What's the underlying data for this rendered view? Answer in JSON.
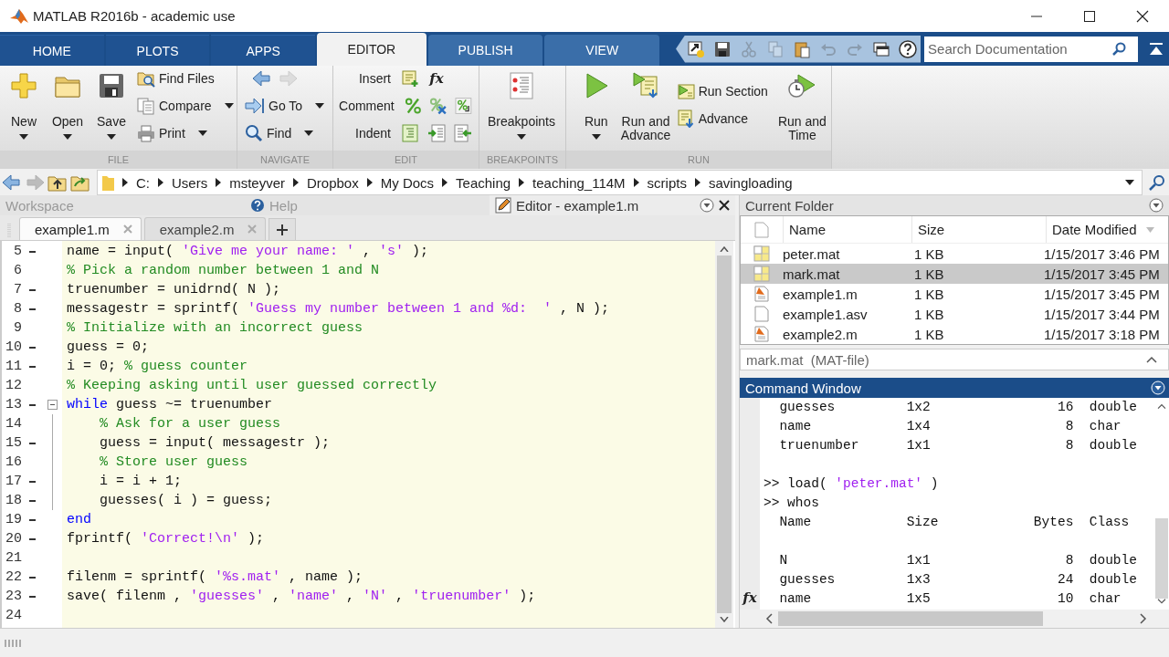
{
  "window": {
    "title": "MATLAB R2016b - academic use"
  },
  "tabs": [
    {
      "label": "HOME",
      "selected": false,
      "kind": "standard"
    },
    {
      "label": "PLOTS",
      "selected": false,
      "kind": "standard"
    },
    {
      "label": "APPS",
      "selected": false,
      "kind": "standard"
    },
    {
      "label": "EDITOR",
      "selected": true,
      "kind": "contextual"
    },
    {
      "label": "PUBLISH",
      "selected": false,
      "kind": "contextual"
    },
    {
      "label": "VIEW",
      "selected": false,
      "kind": "contextual"
    }
  ],
  "quick_access": [
    {
      "disabled": false
    },
    {
      "disabled": false
    },
    {
      "disabled": true
    },
    {
      "disabled": true
    },
    {
      "disabled": false
    },
    {
      "disabled": true
    },
    {
      "disabled": true
    },
    {
      "disabled": false
    },
    {
      "disabled": false
    }
  ],
  "search": {
    "placeholder": "Search Documentation"
  },
  "ribbon": {
    "groups": [
      {
        "label": "FILE",
        "items": [
          {
            "kind": "large",
            "label": "New",
            "dropdown": true
          },
          {
            "kind": "large",
            "label": "Open",
            "dropdown": true
          },
          {
            "kind": "large",
            "label": "Save",
            "dropdown": true
          },
          {
            "kind": "stack",
            "items": [
              {
                "kind": "button",
                "label": "Find Files",
                "dropdown": false
              },
              {
                "kind": "button",
                "label": "Compare",
                "dropdown": true
              },
              {
                "kind": "button",
                "label": "Print",
                "dropdown": true
              }
            ]
          }
        ]
      },
      {
        "label": "NAVIGATE",
        "items": [
          {
            "kind": "stack",
            "items": [
              {
                "kind": "arrows",
                "buttons": [
                  {
                    "disabled": false
                  },
                  {
                    "disabled": true
                  }
                ]
              },
              {
                "kind": "button",
                "label": "Go To",
                "dropdown": true
              },
              {
                "kind": "button",
                "label": "Find",
                "dropdown": true
              }
            ]
          }
        ]
      },
      {
        "label": "EDIT",
        "items": [
          {
            "kind": "stack",
            "items": [
              {
                "kind": "tools",
                "label": "Insert",
                "tools": [
                  {
                    "kind": "icon"
                  },
                  {
                    "kind": "symbol",
                    "symbol": "fx"
                  }
                ]
              },
              {
                "kind": "tools",
                "label": "Comment",
                "tools": [
                  {
                    "kind": "icon"
                  },
                  {
                    "kind": "icon"
                  },
                  {
                    "kind": "icon"
                  }
                ]
              },
              {
                "kind": "tools",
                "label": "Indent",
                "tools": [
                  {
                    "kind": "icon"
                  },
                  {
                    "kind": "icon"
                  },
                  {
                    "kind": "icon"
                  }
                ]
              }
            ]
          }
        ]
      },
      {
        "label": "BREAKPOINTS",
        "items": [
          {
            "kind": "large",
            "label": "Breakpoints",
            "dropdown": true
          }
        ]
      },
      {
        "label": "RUN",
        "items": [
          {
            "kind": "large",
            "label": "Run",
            "dropdown": true
          },
          {
            "kind": "large",
            "label": "Run and Advance",
            "dropdown": false
          },
          {
            "kind": "stack",
            "items": [
              {
                "kind": "button",
                "label": "Run Section",
                "dropdown": false
              },
              {
                "kind": "button",
                "label": "Advance",
                "dropdown": false
              }
            ]
          },
          {
            "kind": "large",
            "label": "Run and Time",
            "dropdown": false
          }
        ]
      }
    ]
  },
  "path_bar": {
    "nav": [
      {
        "disabled": false
      },
      {
        "disabled": true
      },
      {
        "disabled": false
      },
      {
        "disabled": false
      }
    ],
    "segments": [
      "C:",
      "Users",
      "msteyver",
      "Dropbox",
      "My Docs",
      "Teaching",
      "teaching_114M",
      "scripts",
      "savingloading"
    ]
  },
  "panel_tabs": [
    {
      "label": "Workspace",
      "selected": false
    },
    {
      "label": "Help",
      "selected": false
    },
    {
      "label": "Editor - example1.m",
      "selected": true
    }
  ],
  "document_tabs": [
    {
      "label": "example1.m",
      "selected": true
    },
    {
      "label": "example2.m",
      "selected": false
    }
  ],
  "code": {
    "lines": [
      {
        "number": "5",
        "executable": true,
        "tokens": [
          {
            "kind": "plain",
            "text": "name = input( "
          },
          {
            "kind": "string",
            "text": "'Give me your name: '"
          },
          {
            "kind": "plain",
            "text": " , "
          },
          {
            "kind": "string",
            "text": "'s'"
          },
          {
            "kind": "plain",
            "text": " );"
          }
        ]
      },
      {
        "number": "6",
        "executable": false,
        "tokens": [
          {
            "kind": "comment",
            "text": "% Pick a random number between 1 and N"
          }
        ]
      },
      {
        "number": "7",
        "executable": true,
        "tokens": [
          {
            "kind": "plain",
            "text": "truenumber = unidrnd( N );"
          }
        ]
      },
      {
        "number": "8",
        "executable": true,
        "tokens": [
          {
            "kind": "plain",
            "text": "messagestr = sprintf( "
          },
          {
            "kind": "string",
            "text": "'Guess my number between 1 and %d:  '"
          },
          {
            "kind": "plain",
            "text": " , N );"
          }
        ]
      },
      {
        "number": "9",
        "executable": false,
        "tokens": [
          {
            "kind": "comment",
            "text": "% Initialize with an incorrect guess"
          }
        ]
      },
      {
        "number": "10",
        "executable": true,
        "tokens": [
          {
            "kind": "plain",
            "text": "guess = 0;"
          }
        ]
      },
      {
        "number": "11",
        "executable": true,
        "tokens": [
          {
            "kind": "plain",
            "text": "i = 0; "
          },
          {
            "kind": "comment",
            "text": "% guess counter"
          }
        ]
      },
      {
        "number": "12",
        "executable": false,
        "tokens": [
          {
            "kind": "comment",
            "text": "% Keeping asking until user guessed correctly"
          }
        ]
      },
      {
        "number": "13",
        "executable": true,
        "expanded": true,
        "tokens": [
          {
            "kind": "keyword",
            "text": "while"
          },
          {
            "kind": "plain",
            "text": " guess ~= truenumber"
          }
        ],
        "children": [
          {
            "number": "14",
            "executable": false,
            "tokens": [
              {
                "kind": "comment",
                "text": "% Ask for a user guess"
              }
            ]
          },
          {
            "number": "15",
            "executable": true,
            "tokens": [
              {
                "kind": "plain",
                "text": "guess = input( messagestr );"
              }
            ]
          },
          {
            "number": "16",
            "executable": false,
            "tokens": [
              {
                "kind": "comment",
                "text": "% Store user guess"
              }
            ]
          },
          {
            "number": "17",
            "executable": true,
            "tokens": [
              {
                "kind": "plain",
                "text": "i = i + 1;"
              }
            ]
          },
          {
            "number": "18",
            "executable": true,
            "tokens": [
              {
                "kind": "plain",
                "text": "guesses( i ) = guess;"
              }
            ]
          }
        ]
      },
      {
        "number": "19",
        "executable": true,
        "tokens": [
          {
            "kind": "keyword",
            "text": "end"
          }
        ]
      },
      {
        "number": "20",
        "executable": true,
        "tokens": [
          {
            "kind": "plain",
            "text": "fprintf( "
          },
          {
            "kind": "string",
            "text": "'Correct!\\n'"
          },
          {
            "kind": "plain",
            "text": " );"
          }
        ]
      },
      {
        "number": "21",
        "executable": false
      },
      {
        "number": "22",
        "executable": true,
        "tokens": [
          {
            "kind": "plain",
            "text": "filenm = sprintf( "
          },
          {
            "kind": "string",
            "text": "'%s.mat'"
          },
          {
            "kind": "plain",
            "text": " , name );"
          }
        ]
      },
      {
        "number": "23",
        "executable": true,
        "tokens": [
          {
            "kind": "plain",
            "text": "save( filenm , "
          },
          {
            "kind": "string",
            "text": "'guesses'"
          },
          {
            "kind": "plain",
            "text": " , "
          },
          {
            "kind": "string",
            "text": "'name'"
          },
          {
            "kind": "plain",
            "text": " , "
          },
          {
            "kind": "string",
            "text": "'N'"
          },
          {
            "kind": "plain",
            "text": " , "
          },
          {
            "kind": "string",
            "text": "'truenumber'"
          },
          {
            "kind": "plain",
            "text": " );"
          }
        ]
      },
      {
        "number": "24",
        "executable": false
      }
    ]
  },
  "current_folder": {
    "title": "Current Folder",
    "columns": [
      {
        "label": "Name",
        "sorted": false
      },
      {
        "label": "Size",
        "sorted": false
      },
      {
        "label": "Date Modified",
        "sorted": true
      }
    ],
    "rows": [
      {
        "kind": "mat",
        "name": "peter.mat",
        "size": "1 KB",
        "date": "1/15/2017 3:46 PM",
        "selected": false
      },
      {
        "kind": "mat",
        "name": "mark.mat",
        "size": "1 KB",
        "date": "1/15/2017 3:45 PM",
        "selected": true
      },
      {
        "kind": "script",
        "name": "example1.m",
        "size": "1 KB",
        "date": "1/15/2017 3:45 PM",
        "selected": false
      },
      {
        "kind": "plain",
        "name": "example1.asv",
        "size": "1 KB",
        "date": "1/15/2017 3:44 PM",
        "selected": false
      },
      {
        "kind": "script",
        "name": "example2.m",
        "size": "1 KB",
        "date": "1/15/2017 3:18 PM",
        "selected": false
      }
    ],
    "details": "mark.mat  (MAT-file)"
  },
  "command_window": {
    "title": "Command Window",
    "prompt_symbol": "fx",
    "lines": [
      {
        "kind": "row",
        "cells": [
          "guesses",
          "1x2",
          "16",
          "double"
        ]
      },
      {
        "kind": "row",
        "cells": [
          "name",
          "1x4",
          "8",
          "char"
        ]
      },
      {
        "kind": "row",
        "cells": [
          "truenumber",
          "1x1",
          "8",
          "double"
        ]
      },
      {
        "kind": "blank"
      },
      {
        "kind": "prompt",
        "prompt": ">>",
        "tokens": [
          {
            "kind": "plain",
            "text": "load( "
          },
          {
            "kind": "string",
            "text": "'peter.mat'"
          },
          {
            "kind": "plain",
            "text": " )"
          }
        ]
      },
      {
        "kind": "prompt",
        "prompt": ">>",
        "tokens": [
          {
            "kind": "plain",
            "text": "whos"
          }
        ]
      },
      {
        "kind": "row",
        "cells": [
          "Name",
          "Size",
          "Bytes",
          "Class"
        ]
      },
      {
        "kind": "blank"
      },
      {
        "kind": "row",
        "cells": [
          "N",
          "1x1",
          "8",
          "double"
        ]
      },
      {
        "kind": "row",
        "cells": [
          "guesses",
          "1x3",
          "24",
          "double"
        ]
      },
      {
        "kind": "row",
        "cells": [
          "name",
          "1x5",
          "10",
          "char"
        ]
      }
    ]
  }
}
